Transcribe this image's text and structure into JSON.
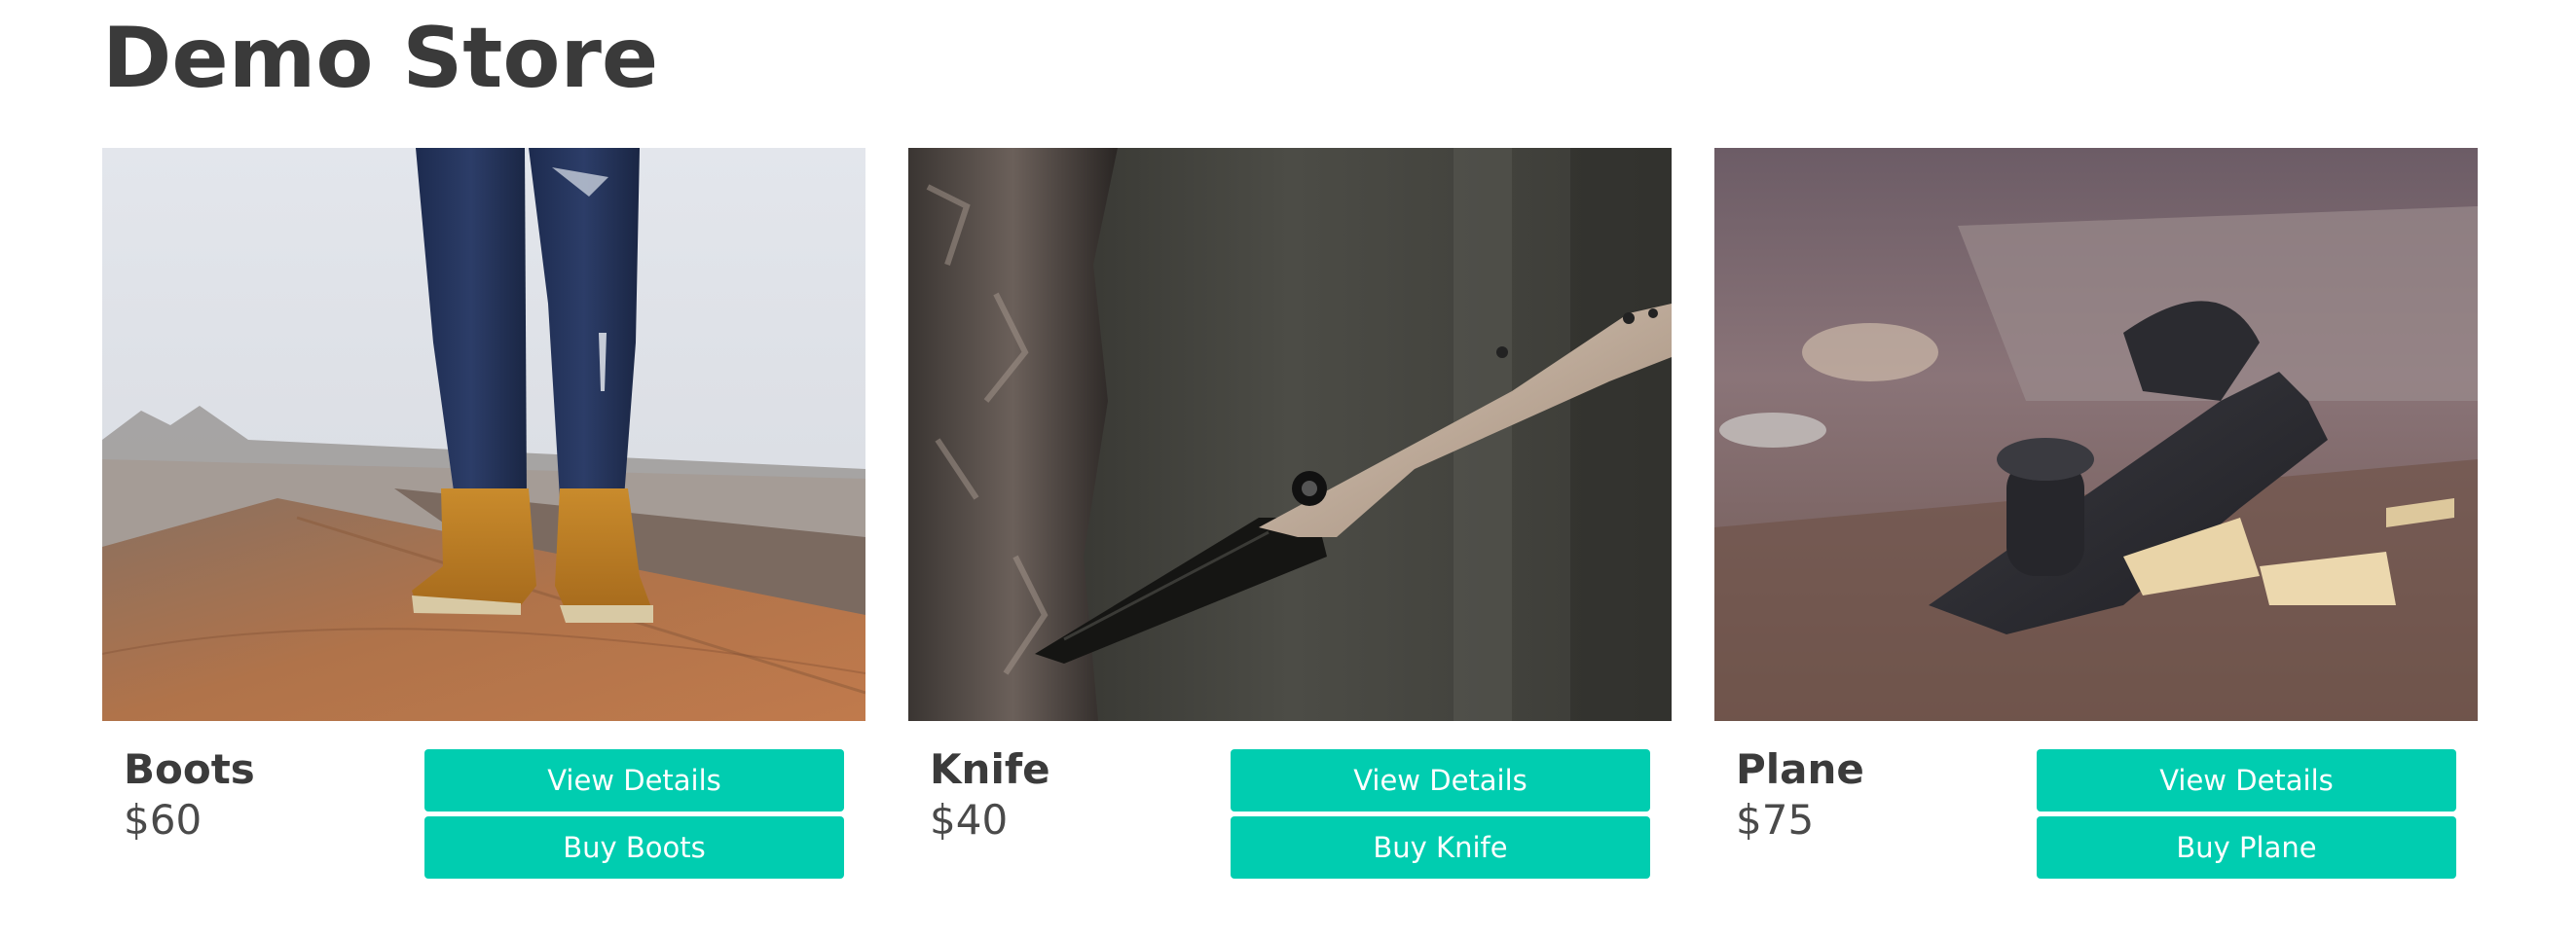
{
  "store": {
    "title": "Demo Store"
  },
  "products": [
    {
      "name": "Boots",
      "price": "$60",
      "details_label": "View Details",
      "buy_label": "Buy Boots"
    },
    {
      "name": "Knife",
      "price": "$40",
      "details_label": "View Details",
      "buy_label": "Buy Knife"
    },
    {
      "name": "Plane",
      "price": "$75",
      "details_label": "View Details",
      "buy_label": "Buy Plane"
    }
  ],
  "colors": {
    "button": "#00cdb0",
    "button_text": "#ffffff",
    "heading_text": "#3a3a3a"
  }
}
